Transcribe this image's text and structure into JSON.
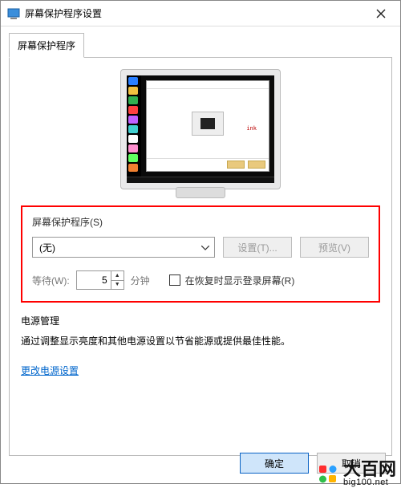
{
  "titlebar": {
    "title": "屏幕保护程序设置"
  },
  "tab": {
    "label": "屏幕保护程序"
  },
  "group": {
    "label": "屏幕保护程序(S)",
    "combo_value": "(无)",
    "settings_btn": "设置(T)...",
    "preview_btn": "预览(V)",
    "wait_label": "等待(W):",
    "wait_value": "5",
    "wait_unit": "分钟",
    "resume_checkbox": "在恢复时显示登录屏幕(R)"
  },
  "power": {
    "label": "电源管理",
    "desc": "通过调整显示亮度和其他电源设置以节省能源或提供最佳性能。",
    "link": "更改电源设置"
  },
  "dialog": {
    "ok": "确定",
    "cancel": "取消"
  },
  "monitor_preview": {
    "brand_text": "ink",
    "icon_colors": [
      "#2a7fff",
      "#f0c040",
      "#30b050",
      "#ff4040",
      "#c060ff",
      "#40d0d0",
      "#ffffff",
      "#ff90d0",
      "#60ff60",
      "#f08030"
    ]
  },
  "watermark": {
    "main": "大百网",
    "sub": "big100.net",
    "logo_colors": {
      "tl": "#ff2e2e",
      "tr": "#2aa0ff",
      "bl": "#2fbf4a",
      "br": "#ffb400"
    }
  }
}
